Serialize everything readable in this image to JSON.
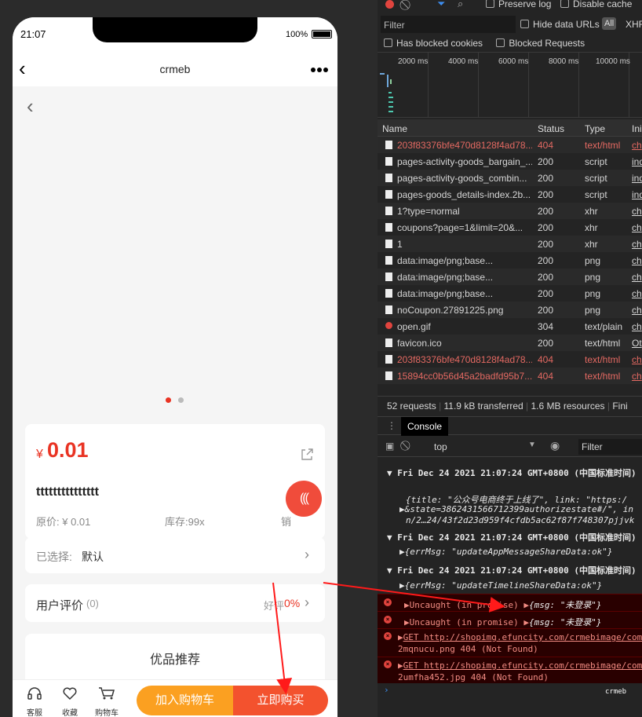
{
  "phone": {
    "time": "21:07",
    "battery": "100%",
    "nav_title": "crmeb",
    "price_symbol": "¥",
    "price": "0.01",
    "product_title": "ttttttttttttttt",
    "original_price": "原价: ¥ 0.01",
    "stock": "库存:99x",
    "sales": "销",
    "spec_label": "已选择:",
    "spec_value": "默认",
    "review_label": "用户评价",
    "review_count": "(0)",
    "good_label": "好评",
    "good_pct": "0%",
    "rec_title": "优品推荐",
    "tabs": [
      "客服",
      "收藏",
      "购物车"
    ],
    "add_to_cart": "加入购物车",
    "buy_now": "立即购买",
    "accent": "#e93323"
  },
  "devtools": {
    "preserve_log": "Preserve log",
    "disable_cache": "Disable cache",
    "filter_placeholder": "Filter",
    "hide_data_urls": "Hide data URLs",
    "all": "All",
    "xhr": "XHR",
    "blocked_cookies": "Has blocked cookies",
    "blocked_requests": "Blocked Requests",
    "ticks": [
      "2000 ms",
      "4000 ms",
      "6000 ms",
      "8000 ms",
      "10000 ms"
    ],
    "columns": [
      "Name",
      "Status",
      "Type",
      "Ini"
    ],
    "rows": [
      {
        "name": "203f83376bfe470d8128f4ad78...",
        "status": "404",
        "type": "text/html",
        "init": "ch",
        "error": true
      },
      {
        "name": "pages-activity-goods_bargain_...",
        "status": "200",
        "type": "script",
        "init": "ind",
        "error": false
      },
      {
        "name": "pages-activity-goods_combin...",
        "status": "200",
        "type": "script",
        "init": "ind",
        "error": false
      },
      {
        "name": "pages-goods_details-index.2b...",
        "status": "200",
        "type": "script",
        "init": "ind",
        "error": false
      },
      {
        "name": "1?type=normal",
        "status": "200",
        "type": "xhr",
        "init": "ch",
        "error": false
      },
      {
        "name": "coupons?page=1&limit=20&...",
        "status": "200",
        "type": "xhr",
        "init": "ch",
        "error": false
      },
      {
        "name": "1",
        "status": "200",
        "type": "xhr",
        "init": "ch",
        "error": false
      },
      {
        "name": "data:image/png;base...",
        "status": "200",
        "type": "png",
        "init": "ch",
        "error": false
      },
      {
        "name": "data:image/png;base...",
        "status": "200",
        "type": "png",
        "init": "ch",
        "error": false
      },
      {
        "name": "data:image/png;base...",
        "status": "200",
        "type": "png",
        "init": "ch",
        "error": false
      },
      {
        "name": "noCoupon.27891225.png",
        "status": "200",
        "type": "png",
        "init": "ch",
        "error": false
      },
      {
        "name": "open.gif",
        "status": "304",
        "type": "text/plain",
        "init": "ch",
        "error": false
      },
      {
        "name": "favicon.ico",
        "status": "200",
        "type": "text/html",
        "init": "Ot",
        "error": false
      },
      {
        "name": "203f83376bfe470d8128f4ad78...",
        "status": "404",
        "type": "text/html",
        "init": "ch",
        "error": true
      },
      {
        "name": "15894cc0b56d45a2badfd95b7...",
        "status": "404",
        "type": "text/html",
        "init": "ch",
        "error": true
      }
    ],
    "summary": [
      "52 requests",
      "11.9 kB transferred",
      "1.6 MB resources",
      "Fini"
    ],
    "console_tab": "Console",
    "context": "top",
    "console_filter": "Filter",
    "console": {
      "group1": "Fri Dec 24 2021 21:07:24 GMT+0800 (中国标准时间)",
      "obj1a": "{title: \"公众号电商终于上线了\", link: \"https:/",
      "obj1b": "&state=3862431566712399authorizestate#/\", in",
      "obj1c": "n/2…24/43f2d23d959f4cfdb5ac62f87f748307pjjvk",
      "group2": "Fri Dec 24 2021 21:07:24 GMT+0800 (中国标准时间)",
      "obj2": "{errMsg: \"updateAppMessageShareData:ok\"}",
      "group3": "Fri Dec 24 2021 21:07:24 GMT+0800 (中国标准时间)",
      "obj3": "{errMsg: \"updateTimelineShareData:ok\"}",
      "err1": "Uncaught (in promise)",
      "err1obj": "{msg: \"未登录\"}",
      "err2": "Uncaught (in promise)",
      "err2obj": "{msg: \"未登录\"}",
      "err3a": "GET http://shopimg.efuncity.com/crmebimage/com",
      "err3b": "2mqnucu.png 404 (Not Found)",
      "err4a": "GET http://shopimg.efuncity.com/crmebimage/com",
      "err4b": "2umfha452.jpg 404 (Not Found)"
    },
    "watermark": "crmeb"
  }
}
